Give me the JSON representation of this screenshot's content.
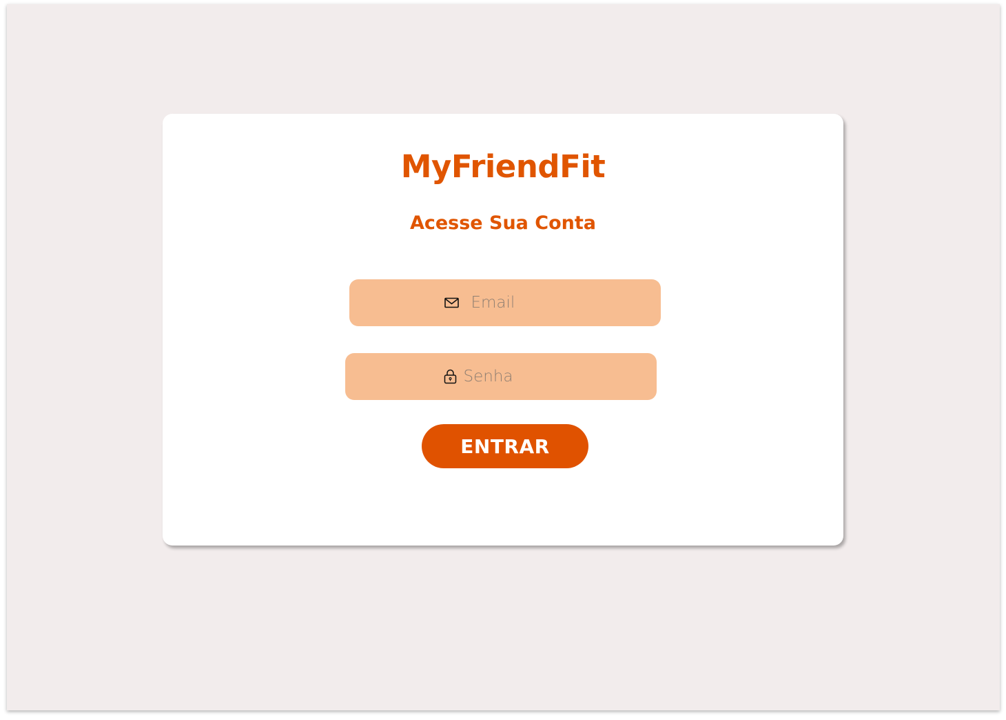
{
  "app": {
    "brand": "MyFriendFit",
    "subtitle": "Acesse Sua Conta"
  },
  "form": {
    "email": {
      "placeholder": "Email",
      "value": "",
      "icon": "mail-icon"
    },
    "password": {
      "placeholder": "Senha",
      "value": "",
      "icon": "lock-icon"
    },
    "submit_label": "ENTRAR"
  },
  "colors": {
    "page_background": "#f2ecec",
    "card_background": "#ffffff",
    "accent": "#e05500",
    "field_background": "#f7bd91",
    "button_text": "#ffffff"
  }
}
